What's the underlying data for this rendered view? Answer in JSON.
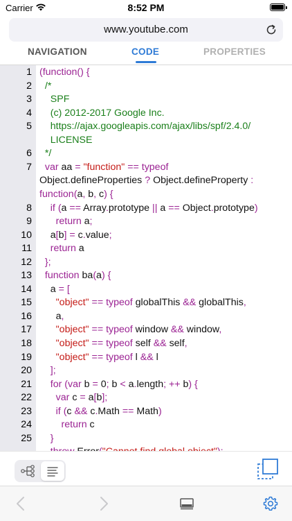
{
  "status_bar": {
    "carrier": "Carrier",
    "time": "8:52 PM"
  },
  "address_bar": {
    "url": "www.youtube.com",
    "reload_icon": "reload-icon"
  },
  "tabs": [
    {
      "label": "NAVIGATION",
      "selected": false
    },
    {
      "label": "CODE",
      "selected": true
    },
    {
      "label": "PROPERTIES",
      "selected": false
    }
  ],
  "code": {
    "line_numbers": [
      "1",
      "2",
      "3",
      "4",
      "5",
      "",
      "6",
      "7",
      "",
      "",
      "8",
      "9",
      "10",
      "11",
      "12",
      "13",
      "14",
      "15",
      "16",
      "17",
      "18",
      "19",
      "20",
      "21",
      "22",
      "23",
      "24",
      "25"
    ],
    "lines": [
      [
        [
          "p",
          "(function() {"
        ]
      ],
      [
        [
          "c",
          "  /*"
        ]
      ],
      [
        [
          "c",
          "    SPF"
        ]
      ],
      [
        [
          "c",
          "    (c) 2012-2017 Google Inc."
        ]
      ],
      [
        [
          "c",
          "    https://ajax.googleapis.com/ajax/libs/spf/2.4.0/"
        ]
      ],
      [
        [
          "c",
          "    LICENSE"
        ]
      ],
      [
        [
          "c",
          "  */"
        ]
      ],
      [
        [
          "k",
          "  var "
        ],
        [
          "b",
          "aa "
        ],
        [
          "p",
          "= "
        ],
        [
          "s",
          "\"function\""
        ],
        [
          "p",
          " == "
        ],
        [
          "k",
          "typeof"
        ]
      ],
      [
        [
          "b",
          "Object.defineProperties "
        ],
        [
          "p",
          "? "
        ],
        [
          "b",
          "Object.defineProperty "
        ],
        [
          "p",
          ":"
        ]
      ],
      [
        [
          "k",
          "function"
        ],
        [
          "p",
          "("
        ],
        [
          "b",
          "a"
        ],
        [
          "p",
          ", "
        ],
        [
          "b",
          "b"
        ],
        [
          "p",
          ", "
        ],
        [
          "b",
          "c"
        ],
        [
          "p",
          ") {"
        ]
      ],
      [
        [
          "k",
          "    if "
        ],
        [
          "p",
          "("
        ],
        [
          "b",
          "a "
        ],
        [
          "p",
          "== "
        ],
        [
          "b",
          "Array"
        ],
        [
          "p",
          "."
        ],
        [
          "b",
          "prototype "
        ],
        [
          "p",
          "|| "
        ],
        [
          "b",
          "a "
        ],
        [
          "p",
          "== "
        ],
        [
          "b",
          "Object"
        ],
        [
          "p",
          "."
        ],
        [
          "b",
          "prototype"
        ],
        [
          "p",
          ")"
        ]
      ],
      [
        [
          "k",
          "      return "
        ],
        [
          "b",
          "a"
        ],
        [
          "p",
          ";"
        ]
      ],
      [
        [
          "b",
          "    a"
        ],
        [
          "p",
          "["
        ],
        [
          "b",
          "b"
        ],
        [
          "p",
          "] = "
        ],
        [
          "b",
          "c"
        ],
        [
          "p",
          "."
        ],
        [
          "b",
          "value"
        ],
        [
          "p",
          ";"
        ]
      ],
      [
        [
          "k",
          "    return "
        ],
        [
          "b",
          "a"
        ]
      ],
      [
        [
          "p",
          "  };"
        ]
      ],
      [
        [
          "k",
          "  function "
        ],
        [
          "b",
          "ba"
        ],
        [
          "p",
          "("
        ],
        [
          "b",
          "a"
        ],
        [
          "p",
          ") {"
        ]
      ],
      [
        [
          "b",
          "    a "
        ],
        [
          "p",
          "= ["
        ]
      ],
      [
        [
          "s",
          "      \"object\""
        ],
        [
          "p",
          " == "
        ],
        [
          "k",
          "typeof "
        ],
        [
          "b",
          "globalThis "
        ],
        [
          "p",
          "&& "
        ],
        [
          "b",
          "globalThis"
        ],
        [
          "p",
          ","
        ]
      ],
      [
        [
          "b",
          "      a"
        ],
        [
          "p",
          ","
        ]
      ],
      [
        [
          "s",
          "      \"object\""
        ],
        [
          "p",
          " == "
        ],
        [
          "k",
          "typeof "
        ],
        [
          "b",
          "window "
        ],
        [
          "p",
          "&& "
        ],
        [
          "b",
          "window"
        ],
        [
          "p",
          ","
        ]
      ],
      [
        [
          "s",
          "      \"object\""
        ],
        [
          "p",
          " == "
        ],
        [
          "k",
          "typeof "
        ],
        [
          "b",
          "self "
        ],
        [
          "p",
          "&& "
        ],
        [
          "b",
          "self"
        ],
        [
          "p",
          ","
        ]
      ],
      [
        [
          "s",
          "      \"object\""
        ],
        [
          "p",
          " == "
        ],
        [
          "k",
          "typeof "
        ],
        [
          "b",
          "l "
        ],
        [
          "p",
          "&& "
        ],
        [
          "b",
          "l"
        ]
      ],
      [
        [
          "p",
          "    ];"
        ]
      ],
      [
        [
          "k",
          "    for "
        ],
        [
          "p",
          "("
        ],
        [
          "k",
          "var "
        ],
        [
          "b",
          "b "
        ],
        [
          "p",
          "= "
        ],
        [
          "b",
          "0"
        ],
        [
          "p",
          "; "
        ],
        [
          "b",
          "b "
        ],
        [
          "p",
          "< "
        ],
        [
          "b",
          "a"
        ],
        [
          "p",
          "."
        ],
        [
          "b",
          "length"
        ],
        [
          "p",
          "; ++ "
        ],
        [
          "b",
          "b"
        ],
        [
          "p",
          ") {"
        ]
      ],
      [
        [
          "k",
          "      var "
        ],
        [
          "b",
          "c "
        ],
        [
          "p",
          "= "
        ],
        [
          "b",
          "a"
        ],
        [
          "p",
          "["
        ],
        [
          "b",
          "b"
        ],
        [
          "p",
          "];"
        ]
      ],
      [
        [
          "k",
          "      if "
        ],
        [
          "p",
          "("
        ],
        [
          "b",
          "c "
        ],
        [
          "p",
          "&& "
        ],
        [
          "b",
          "c"
        ],
        [
          "p",
          "."
        ],
        [
          "b",
          "Math "
        ],
        [
          "p",
          "== "
        ],
        [
          "b",
          "Math"
        ],
        [
          "p",
          ")"
        ]
      ],
      [
        [
          "k",
          "        return "
        ],
        [
          "b",
          "c"
        ]
      ],
      [
        [
          "p",
          "    }"
        ]
      ],
      [
        [
          "k",
          "    throw "
        ],
        [
          "b",
          "Error"
        ],
        [
          "p",
          "("
        ],
        [
          "s",
          "\"Cannot find global object\""
        ],
        [
          "p",
          ");"
        ]
      ]
    ]
  },
  "bottom_tools": {
    "tree_view_icon": "tree-view-icon",
    "list_view_icon": "list-view-icon",
    "expand_icon": "expand-icon"
  },
  "toolbar": {
    "back_icon": "chevron-left-icon",
    "forward_icon": "chevron-right-icon",
    "display_icon": "display-icon",
    "settings_icon": "gear-icon"
  },
  "colors": {
    "accent": "#2f7bd6",
    "keyword": "#9b2393",
    "string": "#c41a16",
    "comment": "#1a7f1a"
  }
}
